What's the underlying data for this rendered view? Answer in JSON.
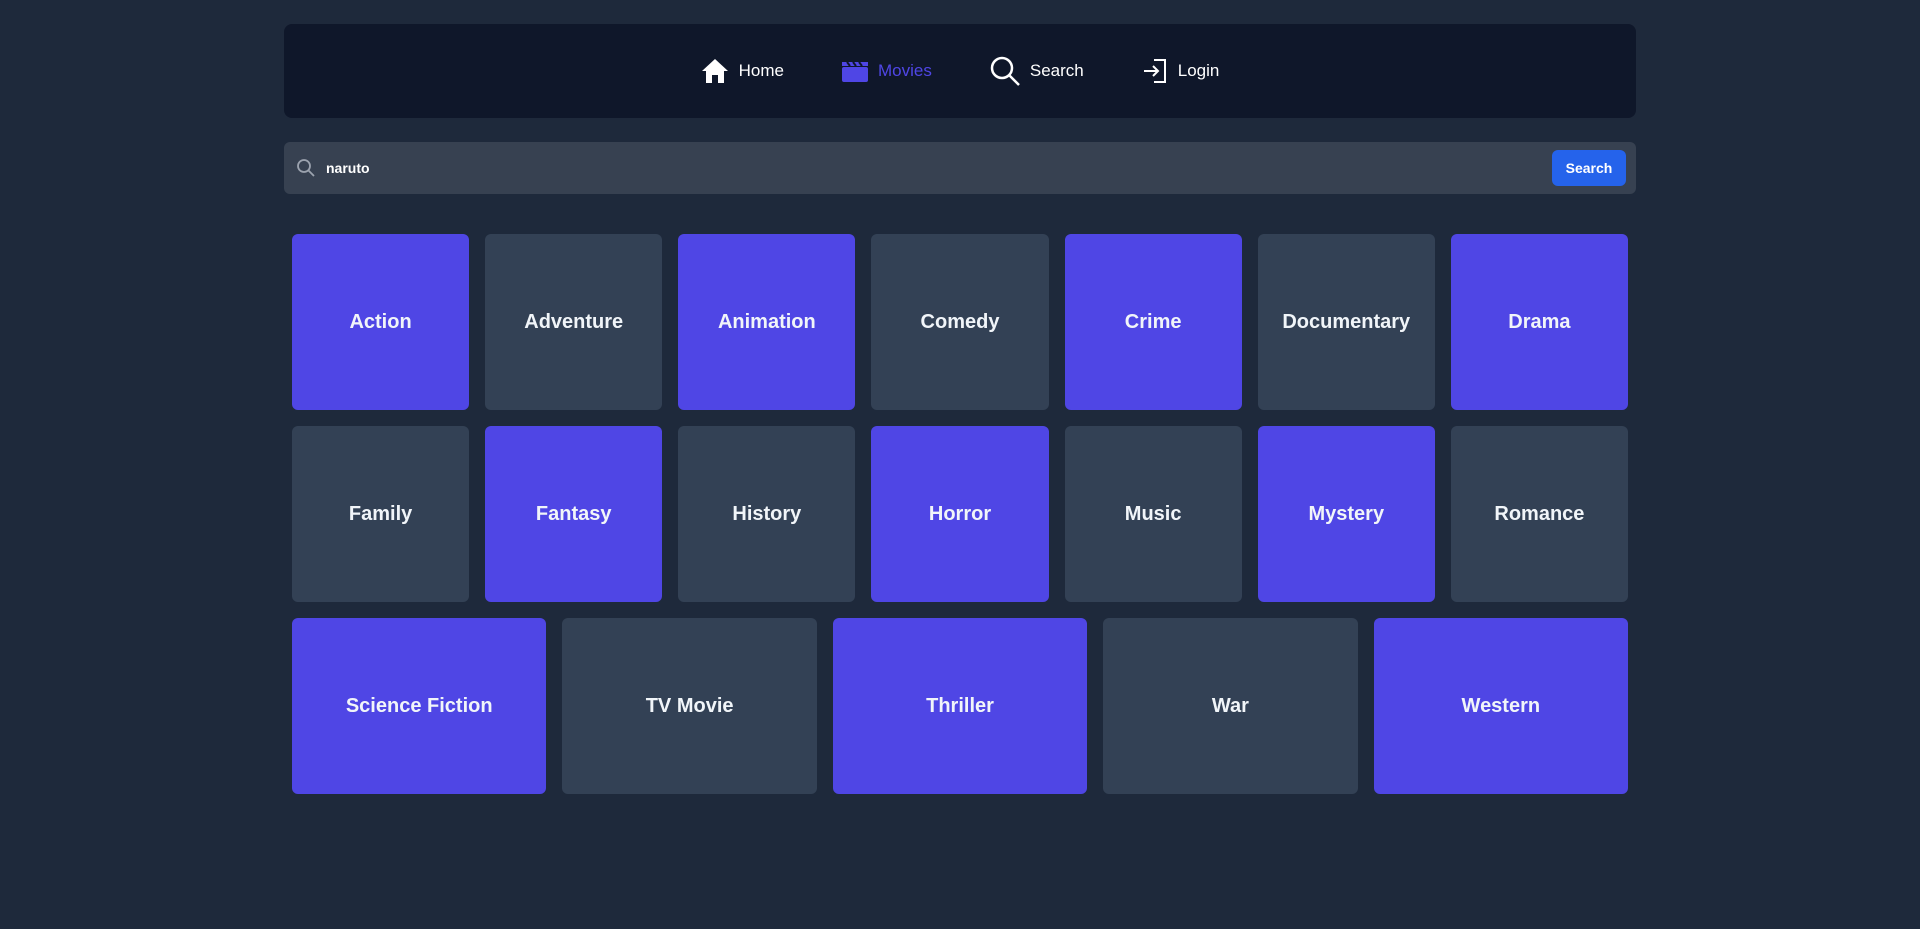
{
  "nav": {
    "home": "Home",
    "movies": "Movies",
    "search": "Search",
    "login": "Login"
  },
  "search": {
    "value": "naruto",
    "button": "Search"
  },
  "colors": {
    "active_nav": "#4f46e5",
    "genre_accent": "#4f46e5",
    "genre_muted": "#334155",
    "search_button": "#2563eb"
  },
  "genres": [
    [
      "Action",
      "Adventure",
      "Animation",
      "Comedy",
      "Crime",
      "Documentary",
      "Drama"
    ],
    [
      "Family",
      "Fantasy",
      "History",
      "Horror",
      "Music",
      "Mystery",
      "Romance"
    ],
    [
      "Science Fiction",
      "TV Movie",
      "Thriller",
      "War",
      "Western"
    ]
  ]
}
